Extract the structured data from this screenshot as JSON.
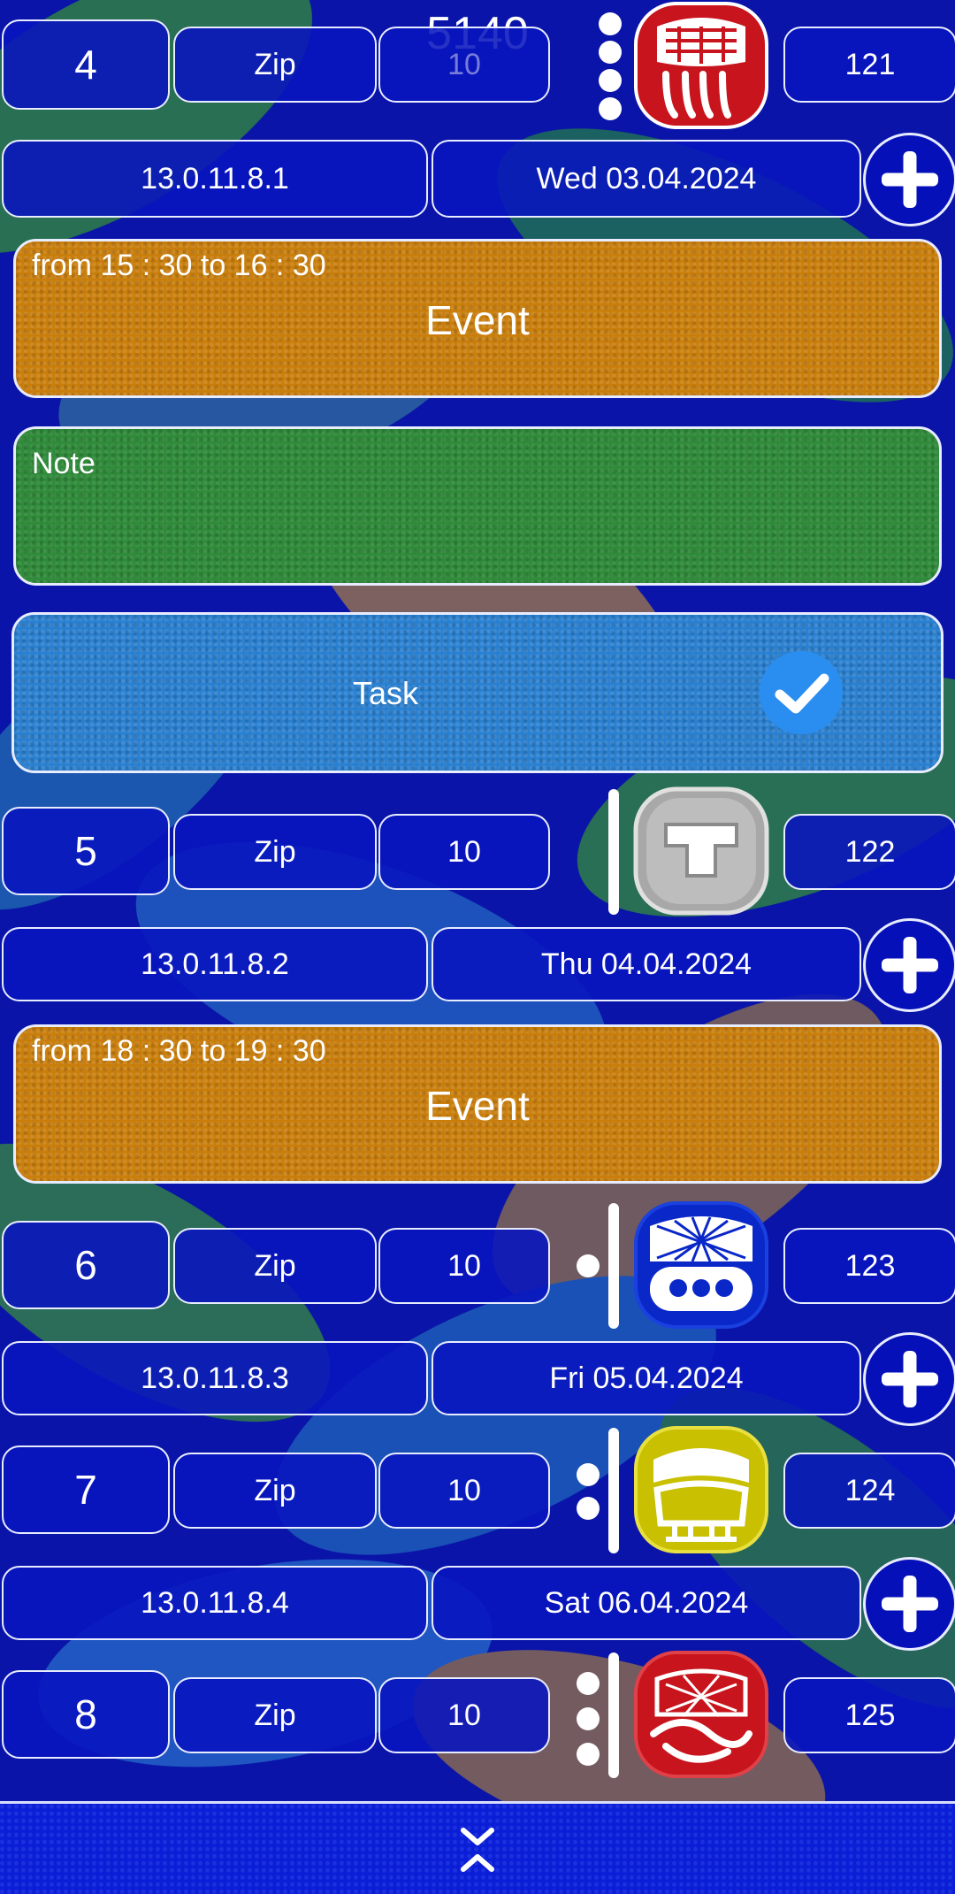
{
  "counter": "5140",
  "days": [
    {
      "num": "4",
      "zip": "Zip",
      "ten": "10",
      "day_num": "121",
      "long_count": "13.0.11.8.1",
      "date": "Wed 03.04.2024",
      "glyph_icon": "mayan-day-glyph-red-icon",
      "dots": 4
    },
    {
      "num": "5",
      "zip": "Zip",
      "ten": "10",
      "day_num": "122",
      "long_count": "13.0.11.8.2",
      "date": "Thu 04.04.2024",
      "glyph_icon": "mayan-day-glyph-white-icon",
      "dots": 0
    },
    {
      "num": "6",
      "zip": "Zip",
      "ten": "10",
      "day_num": "123",
      "long_count": "13.0.11.8.3",
      "date": "Fri 05.04.2024",
      "glyph_icon": "mayan-day-glyph-blue-icon",
      "dots": 1
    },
    {
      "num": "7",
      "zip": "Zip",
      "ten": "10",
      "day_num": "124",
      "long_count": "13.0.11.8.4",
      "date": "Sat 06.04.2024",
      "glyph_icon": "mayan-day-glyph-yellow-icon",
      "dots": 2
    },
    {
      "num": "8",
      "zip": "Zip",
      "ten": "10",
      "day_num": "125",
      "glyph_icon": "mayan-day-glyph-red-icon",
      "dots": 3
    }
  ],
  "entries": {
    "event1": {
      "time": "from 15 : 30 to 16 : 30",
      "title": "Event"
    },
    "note1": {
      "title": "Note"
    },
    "task1": {
      "title": "Task",
      "done": true
    },
    "event2": {
      "time": "from 18 : 30 to 19 : 30",
      "title": "Event"
    }
  },
  "colors": {
    "event": "#c97e0c",
    "note": "#2f8a3a",
    "task": "#2a80d0",
    "glyph_red": "#c8141c",
    "glyph_blue": "#0a28c8",
    "glyph_yellow": "#c8c000",
    "glyph_grey": "#a8a8a8"
  },
  "footer": {
    "icon": "collapse-chevrons-icon"
  }
}
